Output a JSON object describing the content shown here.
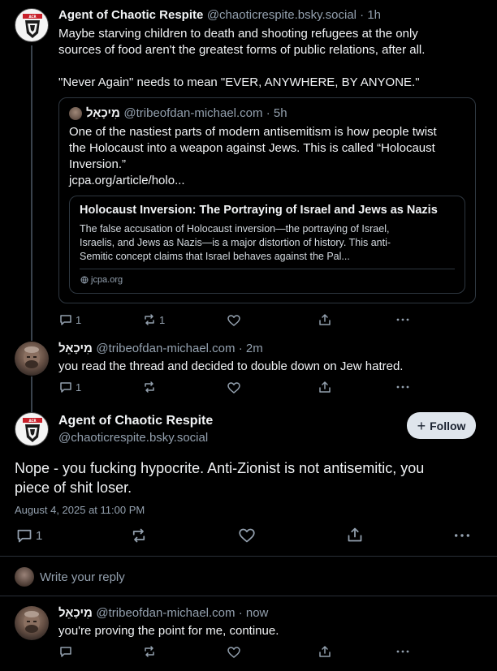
{
  "post1": {
    "author": "Agent of Chaotic Respite",
    "meta": "@chaoticrespite.bsky.social · 1h",
    "line1": "Maybe starving children to death and shooting refugees at the only",
    "line2": "sources of food aren't the greatest forms of public relations, after all.",
    "line3": "\"Never Again\" needs to mean \"EVER, ANYWHERE, BY ANYONE.\"",
    "quote": {
      "author": "מִיכָאֵל",
      "meta": "@tribeofdan-michael.com · 5h",
      "line1": "One of the nastiest parts of modern antisemitism is how people twist",
      "line2": "the Holocaust into a weapon against Jews. This is called “Holocaust",
      "line3": "Inversion.”",
      "link": "jcpa.org/article/holo...",
      "card": {
        "title": "Holocaust Inversion: The Portraying of Israel and Jews as Nazis",
        "desc1": "The false accusation of Holocaust inversion—the portraying of Israel,",
        "desc2": "Israelis, and Jews as Nazis—is a major distortion of history. This anti-",
        "desc3": "Semitic concept claims that Israel behaves against the Pal...",
        "domain": "jcpa.org"
      }
    },
    "replies": "1",
    "reposts": "1"
  },
  "post2": {
    "author": "מִיכָאֵל",
    "meta": "@tribeofdan-michael.com · 2m",
    "text": "you read the thread and decided to double down on Jew hatred.",
    "replies": "1"
  },
  "main": {
    "author": "Agent of Chaotic Respite",
    "handle": "@chaoticrespite.bsky.social",
    "follow_label": "Follow",
    "line1": "Nope - you fucking hypocrite. Anti-Zionist is not antisemitic, you",
    "line2": "piece of shit loser.",
    "timestamp": "August 4, 2025 at 11:00 PM",
    "replies": "1"
  },
  "composer": {
    "placeholder": "Write your reply"
  },
  "post3": {
    "author": "מִיכָאֵל",
    "meta": "@tribeofdan-michael.com · now",
    "text": "you're proving the point for me, continue."
  },
  "avatar_badge": "ACR",
  "colors": {
    "background": "#000000",
    "text": "#f1f3f5",
    "muted": "#93a0ae",
    "border": "#2e3740"
  }
}
